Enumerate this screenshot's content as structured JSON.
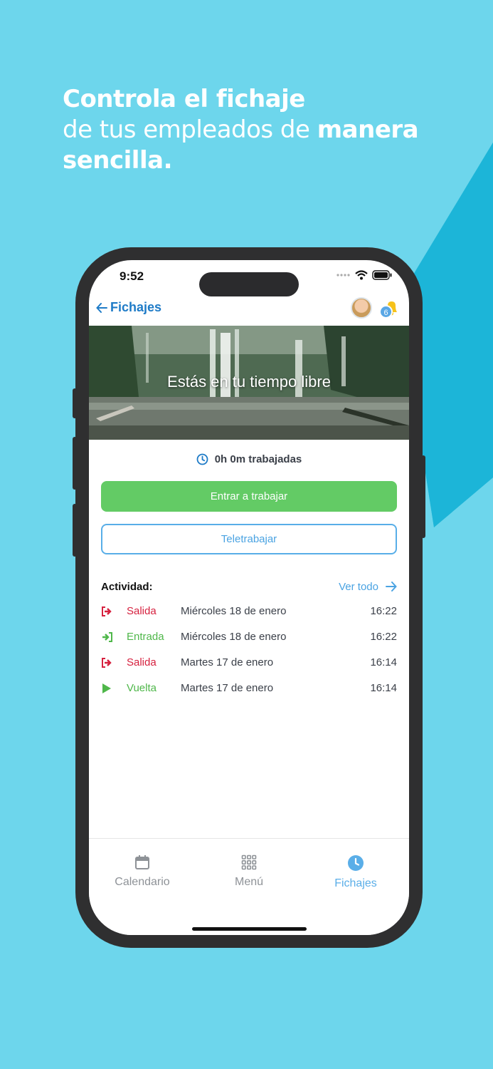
{
  "headline": {
    "line1_bold": "Controla el fichaje",
    "line2_light": "de tus empleados de ",
    "line2_bold": "manera",
    "line3_bold": "sencilla."
  },
  "status_bar": {
    "time": "9:52"
  },
  "navbar": {
    "back_label": "Fichajes",
    "notification_count": "6"
  },
  "hero": {
    "title": "Estás en tu tiempo libre"
  },
  "worked_time": "0h 0m trabajadas",
  "buttons": {
    "enter_work": "Entrar a trabajar",
    "telework": "Teletrabajar"
  },
  "activity": {
    "title": "Actividad:",
    "see_all": "Ver todo",
    "rows": [
      {
        "type": "Salida",
        "date": "Miércoles 18 de enero",
        "time": "16:22",
        "icon": "exit-icon",
        "color": "#d6213f"
      },
      {
        "type": "Entrada",
        "date": "Miércoles 18 de enero",
        "time": "16:22",
        "icon": "enter-icon",
        "color": "#4fb74a"
      },
      {
        "type": "Salida",
        "date": "Martes 17 de enero",
        "time": "16:14",
        "icon": "exit-icon",
        "color": "#d6213f"
      },
      {
        "type": "Vuelta",
        "date": "Martes 17 de enero",
        "time": "16:14",
        "icon": "play-icon",
        "color": "#4fb74a"
      }
    ]
  },
  "tabbar": {
    "items": [
      {
        "label": "Calendario",
        "icon": "calendar-icon"
      },
      {
        "label": "Menú",
        "icon": "grid-icon"
      },
      {
        "label": "Fichajes",
        "icon": "clock-icon"
      }
    ]
  },
  "colors": {
    "background": "#6dd6ec",
    "accent_blue": "#1e7bc7",
    "primary_green": "#63cb65",
    "outline_blue": "#58aee8"
  }
}
